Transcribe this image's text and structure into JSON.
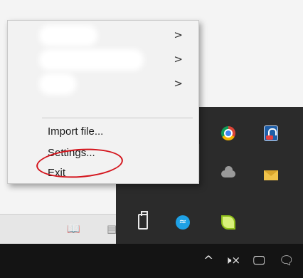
{
  "context_menu": {
    "hidden_items": [
      {
        "arrow": ">"
      },
      {
        "arrow": ">"
      },
      {
        "arrow": ">"
      }
    ],
    "items": [
      {
        "label": "Import file..."
      },
      {
        "label": "Settings..."
      },
      {
        "label": "Exit"
      }
    ]
  },
  "tray_overflow": {
    "icons": [
      "chrome-icon",
      "security-lock-icon",
      "onedrive-cloud-icon",
      "mail-icon",
      "usb-eject-icon",
      "sync-wave-icon",
      "leaf-app-icon"
    ]
  },
  "taskbar": {
    "chevron": "^",
    "volume": "🕨×",
    "network": "🖵",
    "notifications": "🗨"
  },
  "colors": {
    "annotation": "#d4141c",
    "tray_bg": "#2b2b2b",
    "taskbar_bg": "#141414"
  }
}
